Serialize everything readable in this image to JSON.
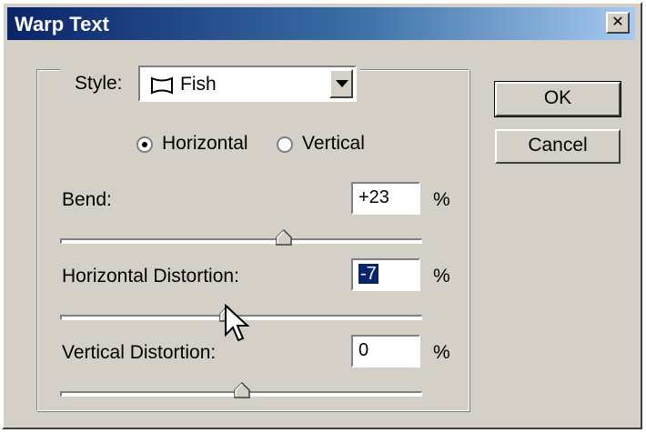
{
  "window": {
    "title": "Warp Text"
  },
  "style": {
    "label": "Style:",
    "value": "Fish",
    "icon": "fish-warp-icon"
  },
  "buttons": {
    "ok": "OK",
    "cancel": "Cancel"
  },
  "orientation": {
    "horizontal": "Horizontal",
    "vertical": "Vertical",
    "selected": "Horizontal"
  },
  "bend": {
    "label": "Bend:",
    "value": "+23",
    "unit": "%"
  },
  "horizontal_distortion": {
    "label": "Horizontal Distortion:",
    "value": "-7",
    "unit": "%"
  },
  "vertical_distortion": {
    "label": "Vertical Distortion:",
    "value": "0",
    "unit": "%"
  }
}
